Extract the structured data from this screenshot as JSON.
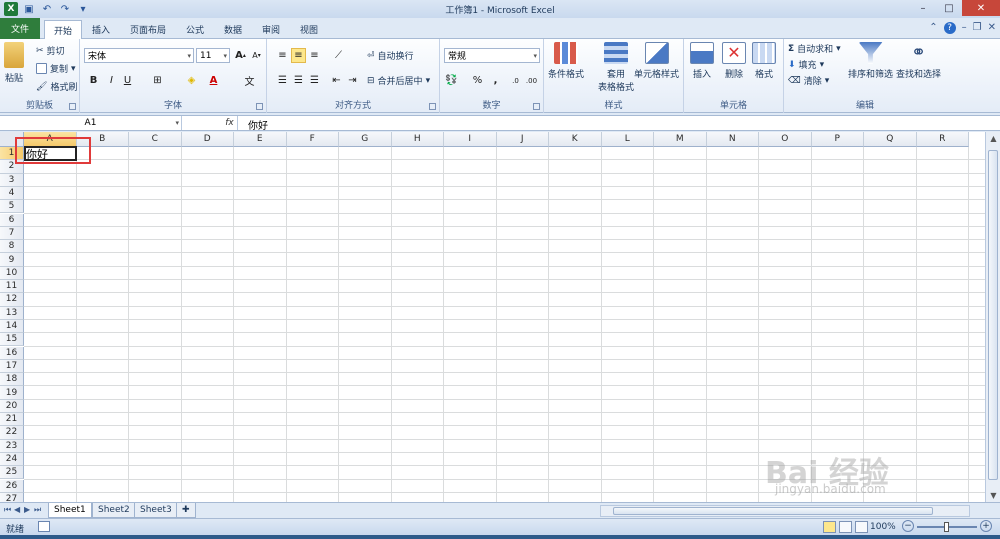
{
  "window": {
    "title": "工作簿1 - Microsoft Excel"
  },
  "tabs": [
    {
      "label": "文件"
    },
    {
      "label": "开始"
    },
    {
      "label": "插入"
    },
    {
      "label": "页面布局"
    },
    {
      "label": "公式"
    },
    {
      "label": "数据"
    },
    {
      "label": "审阅"
    },
    {
      "label": "视图"
    }
  ],
  "ribbon": {
    "clipboard": {
      "paste": "粘贴",
      "cut": "剪切",
      "copy": "复制",
      "format_painter": "格式刷",
      "group": "剪贴板"
    },
    "font": {
      "name": "宋体",
      "size": "11",
      "group": "字体"
    },
    "alignment": {
      "wrap": "自动换行",
      "merge": "合并后居中",
      "group": "对齐方式"
    },
    "number": {
      "format": "常规",
      "group": "数字"
    },
    "styles": {
      "conditional": "条件格式",
      "table_line1": "套用",
      "table_line2": "表格格式",
      "cell_styles": "单元格样式",
      "group": "样式"
    },
    "cells": {
      "insert": "插入",
      "delete": "删除",
      "format": "格式",
      "group": "单元格"
    },
    "editing": {
      "autosum": "自动求和",
      "fill": "填充",
      "clear": "清除",
      "sort": "排序和筛选",
      "find": "查找和选择",
      "group": "编辑"
    }
  },
  "formula_bar": {
    "name_box": "A1",
    "fx": "fx",
    "content": "你好"
  },
  "columns": [
    "A",
    "B",
    "C",
    "D",
    "E",
    "F",
    "G",
    "H",
    "I",
    "J",
    "K",
    "L",
    "M",
    "N",
    "O",
    "P",
    "Q",
    "R"
  ],
  "rows": [
    "1",
    "2",
    "3",
    "4",
    "5",
    "6",
    "7",
    "8",
    "9",
    "10",
    "11",
    "12",
    "13",
    "14",
    "15",
    "16",
    "17",
    "18",
    "19",
    "20",
    "21",
    "22",
    "23",
    "24",
    "25",
    "26",
    "27"
  ],
  "cells": {
    "A1": "你好"
  },
  "sheets": [
    "Sheet1",
    "Sheet2",
    "Sheet3"
  ],
  "status": {
    "ready": "就绪",
    "zoom": "100%"
  },
  "watermark": {
    "brand": "Bai 经验",
    "url": "jingyan.baidu.com"
  }
}
